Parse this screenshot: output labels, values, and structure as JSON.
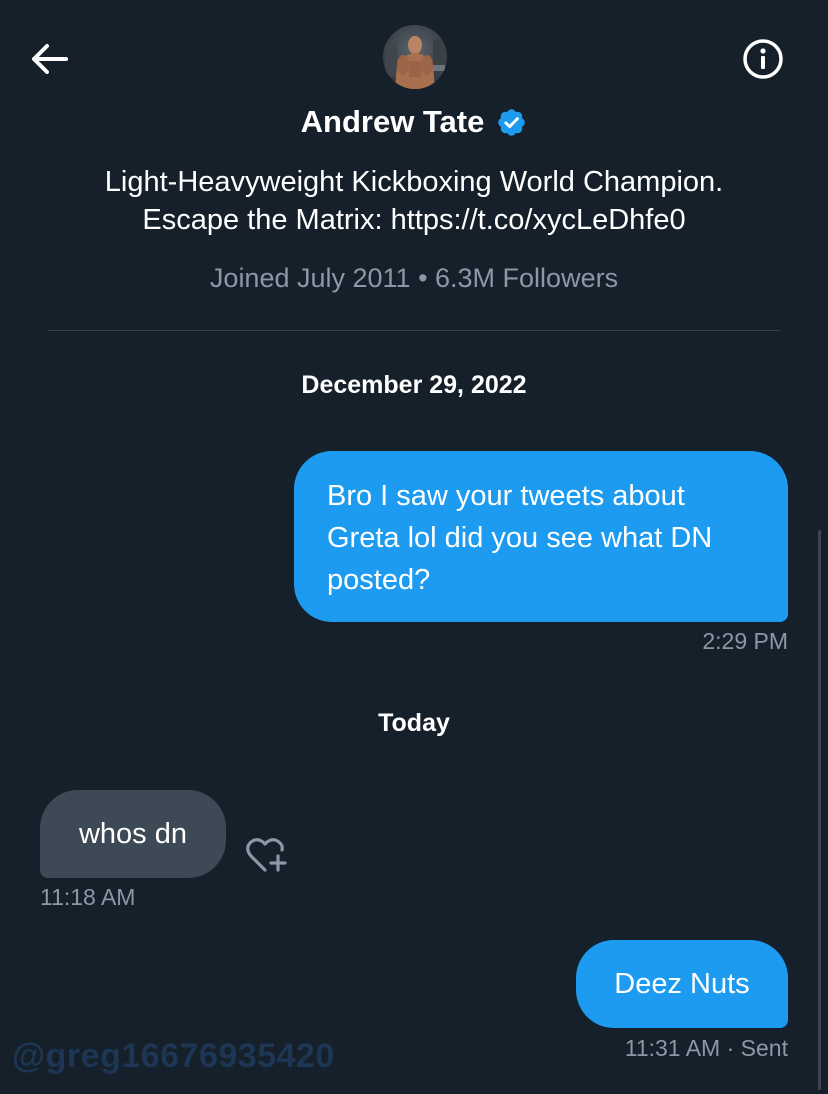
{
  "header": {
    "back_icon": "arrow-left-icon",
    "info_icon": "info-circle-icon",
    "avatar_icon": "profile-photo"
  },
  "profile": {
    "name": "Andrew Tate",
    "verified_icon": "verified-badge-icon",
    "verified_color": "#1d9bf0",
    "bio_line1": "Light-Heavyweight Kickboxing World Champion.",
    "bio_line2": "Escape the Matrix: https://t.co/xycLeDhfe0",
    "meta": "Joined July 2011 • 6.3M Followers"
  },
  "conversation": {
    "date_1": "December 29, 2022",
    "date_2": "Today",
    "messages": [
      {
        "direction": "outgoing",
        "text": "Bro I saw your tweets about Greta lol did you see what DN posted?",
        "time": "2:29 PM"
      },
      {
        "direction": "incoming",
        "text": "whos dn",
        "time": "11:18 AM"
      },
      {
        "direction": "outgoing",
        "text": "Deez Nuts",
        "time": "11:31 AM",
        "status": "Sent"
      }
    ],
    "react_icon": "heart-plus-icon"
  },
  "watermark": "@greg16676935420",
  "colors": {
    "background": "#15202b",
    "outgoing_bubble": "#1d9bf0",
    "incoming_bubble": "#3d4a56",
    "secondary_text": "#8b98a5"
  }
}
